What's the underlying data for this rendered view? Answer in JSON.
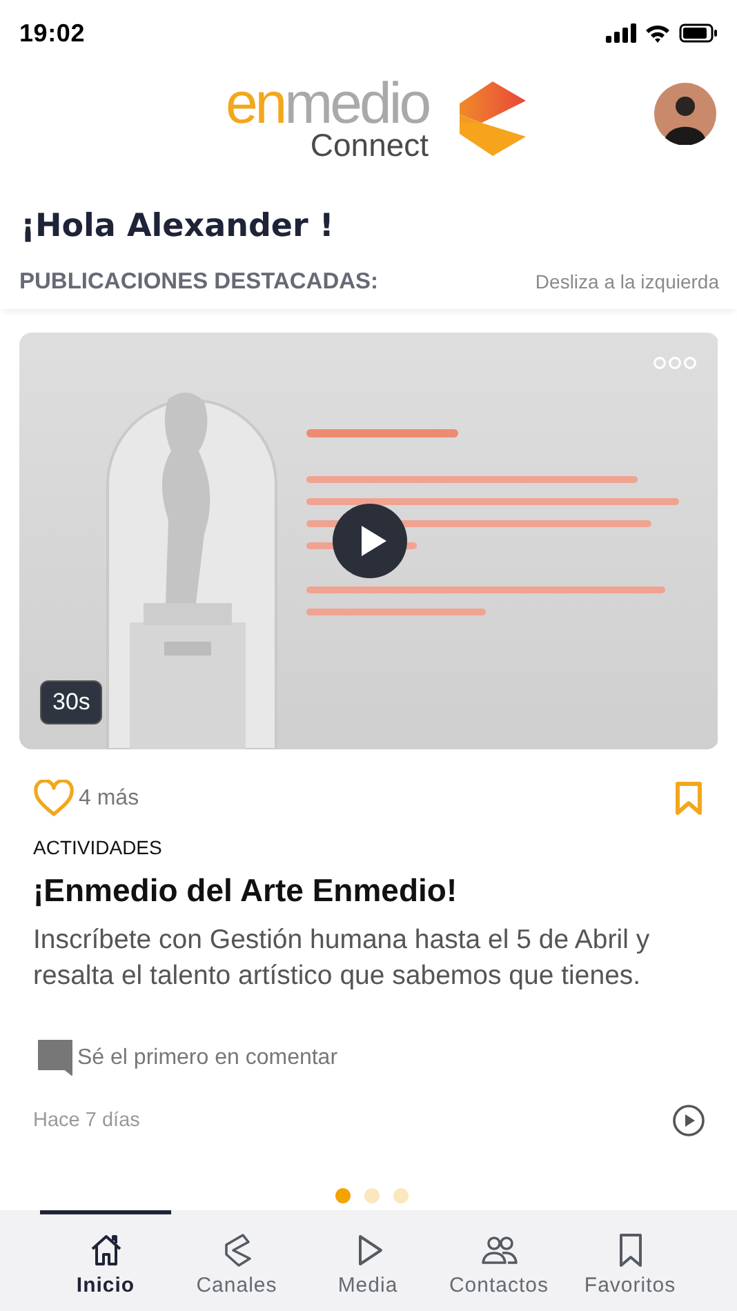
{
  "status_bar": {
    "time": "19:02"
  },
  "header": {
    "logo_part_a": "en",
    "logo_part_b": "medio",
    "logo_sub": "Connect"
  },
  "greeting": "¡Hola Alexander !",
  "section": {
    "title": "PUBLICACIONES DESTACADAS:",
    "hint": "Desliza a la izquierda"
  },
  "post": {
    "media": {
      "kind": "picture",
      "duration": "30s"
    },
    "liked": false,
    "likes": "4 más",
    "saved": false,
    "category": "ACTIVIDADES",
    "title": "¡Enmedio del Arte Enmedio!",
    "body": "Inscríbete con Gestión humana hasta el 5 de Abril y resalta el talento artístico que sabemos que tienes.",
    "comment_prompt": "Sé el primero en comentar",
    "time": "Hace 7 días"
  },
  "pager": [
    {
      "selected": true
    },
    {
      "selected": false
    },
    {
      "selected": false
    }
  ],
  "nav": [
    {
      "label": "Inicio",
      "kind": "home",
      "selected": true
    },
    {
      "label": "Canales",
      "kind": "channels",
      "selected": false
    },
    {
      "label": "Media",
      "kind": "media",
      "selected": false
    },
    {
      "label": "Contactos",
      "kind": "contacts",
      "selected": false
    },
    {
      "label": "Favoritos",
      "kind": "favorites",
      "selected": false
    }
  ]
}
